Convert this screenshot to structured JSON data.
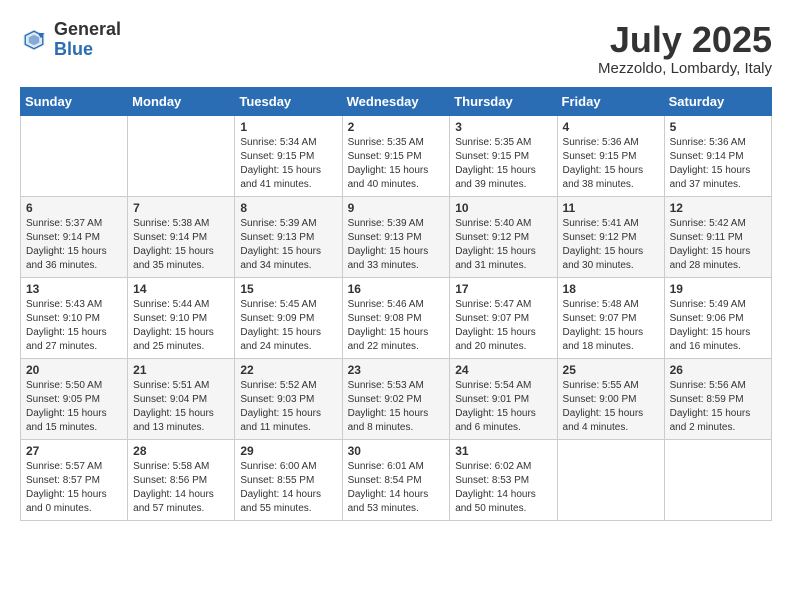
{
  "header": {
    "logo_general": "General",
    "logo_blue": "Blue",
    "month_title": "July 2025",
    "location": "Mezzoldo, Lombardy, Italy"
  },
  "weekdays": [
    "Sunday",
    "Monday",
    "Tuesday",
    "Wednesday",
    "Thursday",
    "Friday",
    "Saturday"
  ],
  "weeks": [
    [
      {
        "day": "",
        "info": ""
      },
      {
        "day": "",
        "info": ""
      },
      {
        "day": "1",
        "info": "Sunrise: 5:34 AM\nSunset: 9:15 PM\nDaylight: 15 hours\nand 41 minutes."
      },
      {
        "day": "2",
        "info": "Sunrise: 5:35 AM\nSunset: 9:15 PM\nDaylight: 15 hours\nand 40 minutes."
      },
      {
        "day": "3",
        "info": "Sunrise: 5:35 AM\nSunset: 9:15 PM\nDaylight: 15 hours\nand 39 minutes."
      },
      {
        "day": "4",
        "info": "Sunrise: 5:36 AM\nSunset: 9:15 PM\nDaylight: 15 hours\nand 38 minutes."
      },
      {
        "day": "5",
        "info": "Sunrise: 5:36 AM\nSunset: 9:14 PM\nDaylight: 15 hours\nand 37 minutes."
      }
    ],
    [
      {
        "day": "6",
        "info": "Sunrise: 5:37 AM\nSunset: 9:14 PM\nDaylight: 15 hours\nand 36 minutes."
      },
      {
        "day": "7",
        "info": "Sunrise: 5:38 AM\nSunset: 9:14 PM\nDaylight: 15 hours\nand 35 minutes."
      },
      {
        "day": "8",
        "info": "Sunrise: 5:39 AM\nSunset: 9:13 PM\nDaylight: 15 hours\nand 34 minutes."
      },
      {
        "day": "9",
        "info": "Sunrise: 5:39 AM\nSunset: 9:13 PM\nDaylight: 15 hours\nand 33 minutes."
      },
      {
        "day": "10",
        "info": "Sunrise: 5:40 AM\nSunset: 9:12 PM\nDaylight: 15 hours\nand 31 minutes."
      },
      {
        "day": "11",
        "info": "Sunrise: 5:41 AM\nSunset: 9:12 PM\nDaylight: 15 hours\nand 30 minutes."
      },
      {
        "day": "12",
        "info": "Sunrise: 5:42 AM\nSunset: 9:11 PM\nDaylight: 15 hours\nand 28 minutes."
      }
    ],
    [
      {
        "day": "13",
        "info": "Sunrise: 5:43 AM\nSunset: 9:10 PM\nDaylight: 15 hours\nand 27 minutes."
      },
      {
        "day": "14",
        "info": "Sunrise: 5:44 AM\nSunset: 9:10 PM\nDaylight: 15 hours\nand 25 minutes."
      },
      {
        "day": "15",
        "info": "Sunrise: 5:45 AM\nSunset: 9:09 PM\nDaylight: 15 hours\nand 24 minutes."
      },
      {
        "day": "16",
        "info": "Sunrise: 5:46 AM\nSunset: 9:08 PM\nDaylight: 15 hours\nand 22 minutes."
      },
      {
        "day": "17",
        "info": "Sunrise: 5:47 AM\nSunset: 9:07 PM\nDaylight: 15 hours\nand 20 minutes."
      },
      {
        "day": "18",
        "info": "Sunrise: 5:48 AM\nSunset: 9:07 PM\nDaylight: 15 hours\nand 18 minutes."
      },
      {
        "day": "19",
        "info": "Sunrise: 5:49 AM\nSunset: 9:06 PM\nDaylight: 15 hours\nand 16 minutes."
      }
    ],
    [
      {
        "day": "20",
        "info": "Sunrise: 5:50 AM\nSunset: 9:05 PM\nDaylight: 15 hours\nand 15 minutes."
      },
      {
        "day": "21",
        "info": "Sunrise: 5:51 AM\nSunset: 9:04 PM\nDaylight: 15 hours\nand 13 minutes."
      },
      {
        "day": "22",
        "info": "Sunrise: 5:52 AM\nSunset: 9:03 PM\nDaylight: 15 hours\nand 11 minutes."
      },
      {
        "day": "23",
        "info": "Sunrise: 5:53 AM\nSunset: 9:02 PM\nDaylight: 15 hours\nand 8 minutes."
      },
      {
        "day": "24",
        "info": "Sunrise: 5:54 AM\nSunset: 9:01 PM\nDaylight: 15 hours\nand 6 minutes."
      },
      {
        "day": "25",
        "info": "Sunrise: 5:55 AM\nSunset: 9:00 PM\nDaylight: 15 hours\nand 4 minutes."
      },
      {
        "day": "26",
        "info": "Sunrise: 5:56 AM\nSunset: 8:59 PM\nDaylight: 15 hours\nand 2 minutes."
      }
    ],
    [
      {
        "day": "27",
        "info": "Sunrise: 5:57 AM\nSunset: 8:57 PM\nDaylight: 15 hours\nand 0 minutes."
      },
      {
        "day": "28",
        "info": "Sunrise: 5:58 AM\nSunset: 8:56 PM\nDaylight: 14 hours\nand 57 minutes."
      },
      {
        "day": "29",
        "info": "Sunrise: 6:00 AM\nSunset: 8:55 PM\nDaylight: 14 hours\nand 55 minutes."
      },
      {
        "day": "30",
        "info": "Sunrise: 6:01 AM\nSunset: 8:54 PM\nDaylight: 14 hours\nand 53 minutes."
      },
      {
        "day": "31",
        "info": "Sunrise: 6:02 AM\nSunset: 8:53 PM\nDaylight: 14 hours\nand 50 minutes."
      },
      {
        "day": "",
        "info": ""
      },
      {
        "day": "",
        "info": ""
      }
    ]
  ]
}
